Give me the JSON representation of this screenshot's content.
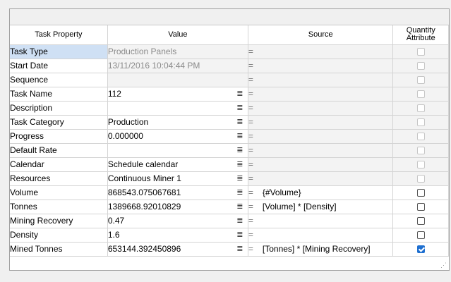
{
  "columns": {
    "task_property": "Task Property",
    "value": "Value",
    "source": "Source",
    "quantity_attribute_line1": "Quantity",
    "quantity_attribute_line2": "Attribute"
  },
  "rows": [
    {
      "property": "Task Type",
      "value": "Production Panels",
      "source_eq": "=",
      "source": "",
      "readonly": true,
      "has_menu": false,
      "checked": false
    },
    {
      "property": "Start Date",
      "value": "13/11/2016 10:04:44 PM",
      "source_eq": "=",
      "source": "",
      "readonly": true,
      "has_menu": false,
      "checked": false
    },
    {
      "property": "Sequence",
      "value": "",
      "source_eq": "=",
      "source": "",
      "readonly": true,
      "has_menu": false,
      "checked": false
    },
    {
      "property": "Task Name",
      "value": "112",
      "source_eq": "=",
      "source": "",
      "readonly": false,
      "has_menu": true,
      "checked": false
    },
    {
      "property": "Description",
      "value": "",
      "source_eq": "=",
      "source": "",
      "readonly": false,
      "has_menu": true,
      "checked": false
    },
    {
      "property": "Task Category",
      "value": "Production",
      "source_eq": "=",
      "source": "",
      "readonly": false,
      "has_menu": true,
      "checked": false
    },
    {
      "property": "Progress",
      "value": "0.000000",
      "source_eq": "=",
      "source": "",
      "readonly": false,
      "has_menu": true,
      "checked": false
    },
    {
      "property": "Default Rate",
      "value": "",
      "source_eq": "=",
      "source": "",
      "readonly": false,
      "has_menu": true,
      "checked": false
    },
    {
      "property": "Calendar",
      "value": "Schedule calendar",
      "source_eq": "=",
      "source": "",
      "readonly": false,
      "has_menu": true,
      "checked": false
    },
    {
      "property": "Resources",
      "value": "Continuous Miner 1",
      "source_eq": "=",
      "source": "",
      "readonly": false,
      "has_menu": true,
      "checked": false
    },
    {
      "property": "Volume",
      "value": "868543.075067681",
      "source_eq": "=",
      "source": "{#Volume}",
      "readonly": false,
      "has_menu": true,
      "checked": false,
      "qa_enabled": true
    },
    {
      "property": "Tonnes",
      "value": "1389668.92010829",
      "source_eq": "=",
      "source": "[Volume] * [Density]",
      "readonly": false,
      "has_menu": true,
      "checked": false,
      "qa_enabled": true
    },
    {
      "property": "Mining Recovery",
      "value": "0.47",
      "source_eq": "=",
      "source": "",
      "readonly": false,
      "has_menu": true,
      "checked": false,
      "qa_enabled": true
    },
    {
      "property": "Density",
      "value": "1.6",
      "source_eq": "=",
      "source": "",
      "readonly": false,
      "has_menu": true,
      "checked": false,
      "qa_enabled": true
    },
    {
      "property": "Mined Tonnes",
      "value": "653144.392450896",
      "source_eq": "=",
      "source": "[Tonnes] * [Mining Recovery]",
      "readonly": false,
      "has_menu": true,
      "checked": true,
      "qa_enabled": true
    }
  ],
  "icons": {
    "menu": "menu-lines-icon",
    "grip": "resize-grip-icon"
  }
}
